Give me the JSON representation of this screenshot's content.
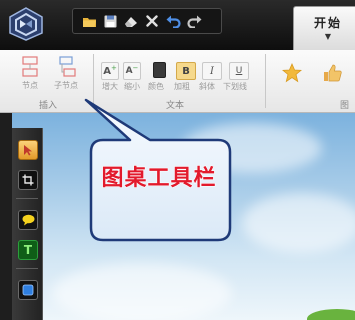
{
  "window": {
    "tab_start": "开始",
    "tab_start_arrow": "▼"
  },
  "quick_access": {
    "icons": [
      "open-folder-icon",
      "save-icon",
      "clear-icon",
      "delete-icon",
      "undo-icon",
      "redo-icon"
    ],
    "accent": "#e8b33a"
  },
  "ribbon": {
    "insert_group": {
      "label": "插入",
      "node_label": "节点",
      "child_node_label": "子节点"
    },
    "text_group": {
      "label": "文本",
      "grow_label": "增大",
      "shrink_label": "缩小",
      "color_label": "颜色",
      "bold_label": "加粗",
      "italic_label": "斜体",
      "underline_label": "下划线",
      "bold_glyph": "B",
      "italic_glyph": "I",
      "underline_glyph": "U",
      "grow_glyph": "A",
      "shrink_glyph": "A"
    },
    "icons_group": {
      "label": "图标"
    }
  },
  "callout": {
    "text": "图桌工具栏",
    "text_color": "#e21a2c"
  },
  "toolbar": {
    "tools": [
      "select-arrow-icon",
      "crop-icon",
      "speech-bubble-icon",
      "text-tool-icon",
      "shape-tool-icon"
    ]
  }
}
